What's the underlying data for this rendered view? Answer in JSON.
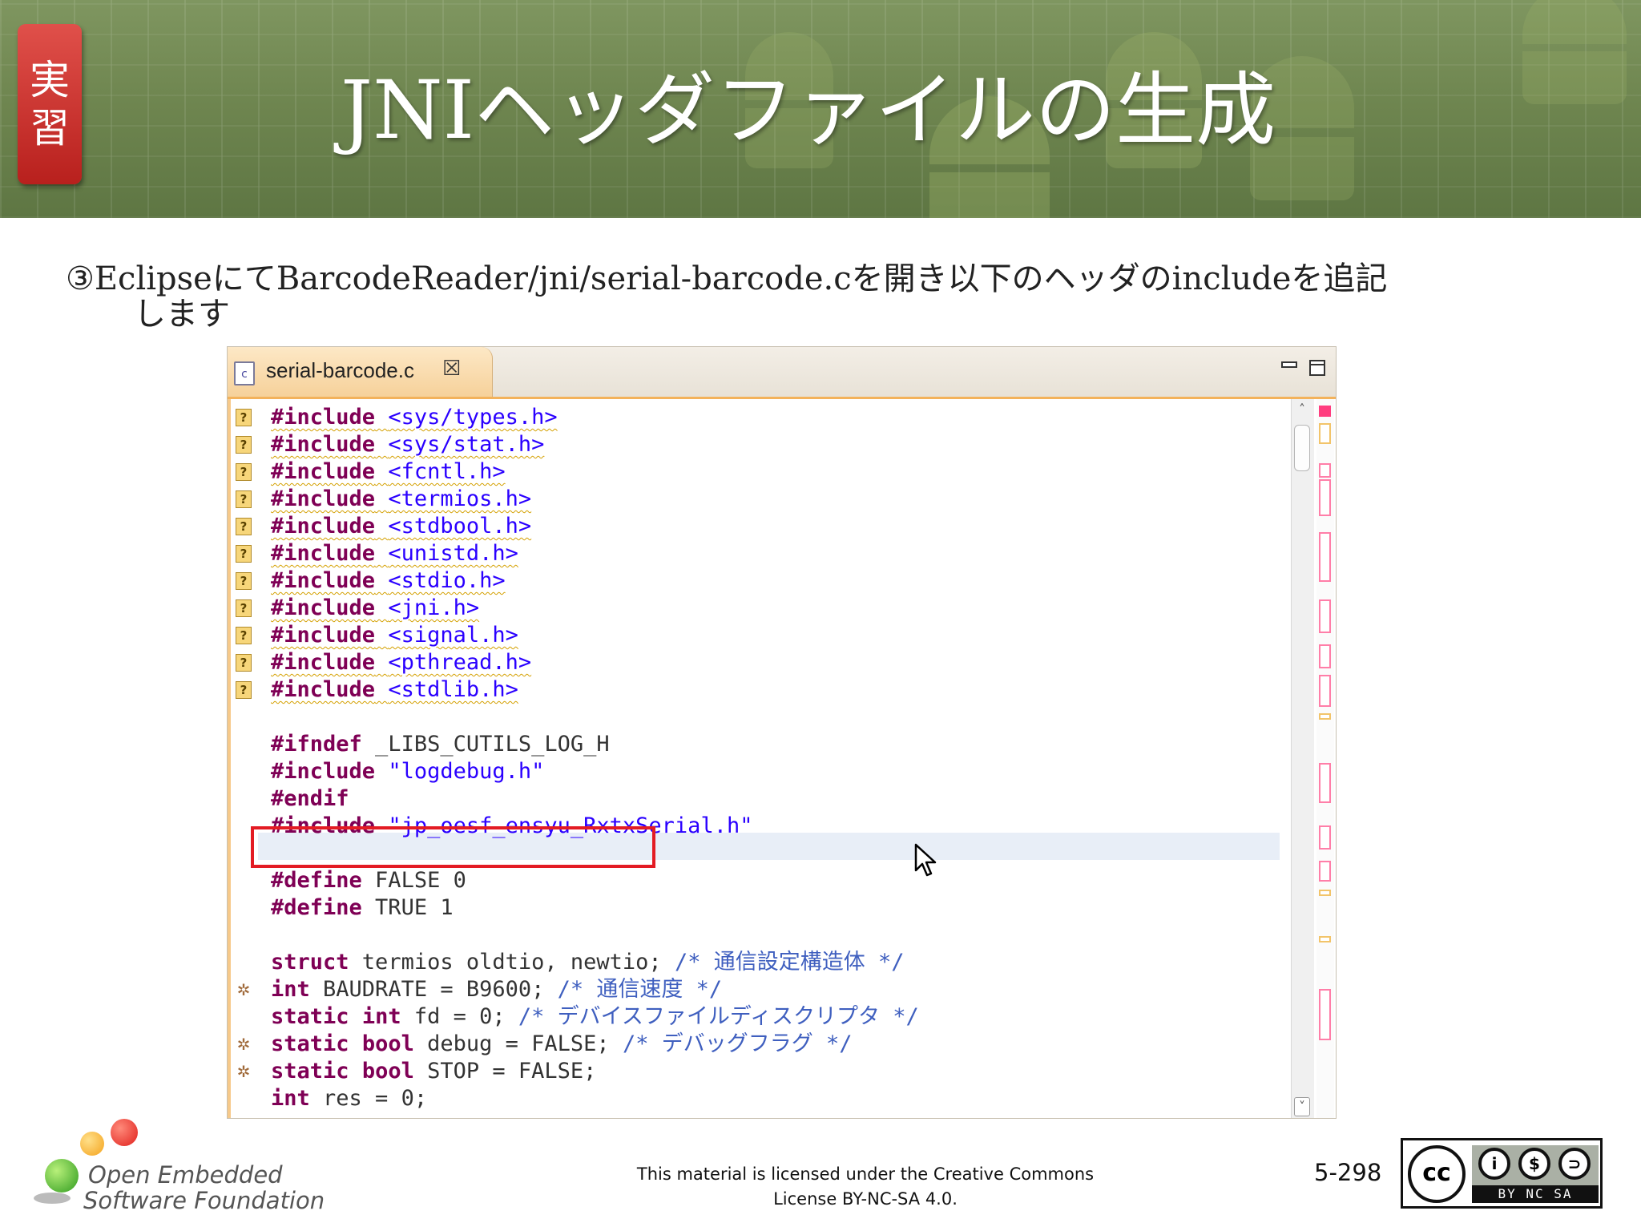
{
  "slide": {
    "badge": "実\n習",
    "title": "JNIヘッダファイルの生成",
    "instruction_line1": "③EclipseにてBarcodeReader/jni/serial-barcode.cを開き以下のヘッダのincludeを追記",
    "instruction_line2": "します"
  },
  "editor": {
    "tab_label": "serial-barcode.c",
    "tab_close": "☒",
    "minimize": "▭",
    "maximize": "□",
    "code_lines": [
      "#include <sys/types.h>",
      "#include <sys/stat.h>",
      "#include <fcntl.h>",
      "#include <termios.h>",
      "#include <stdbool.h>",
      "#include <unistd.h>",
      "#include <stdio.h>",
      "#include <jni.h>",
      "#include <signal.h>",
      "#include <pthread.h>",
      "#include <stdlib.h>",
      "",
      "#ifndef _LIBS_CUTILS_LOG_H",
      "#include \"logdebug.h\"",
      "#endif",
      "#include \"jp_oesf_ensyu_RxtxSerial.h\"",
      "",
      "#define FALSE 0",
      "#define TRUE 1",
      "",
      "struct termios oldtio, newtio; /* 通信設定構造体 */",
      "int BAUDRATE = B9600; /* 通信速度 */",
      "static int fd = 0; /* デバイスファイルディスクリプタ */",
      "static bool debug = FALSE; /* デバッグフラグ */",
      "static bool STOP = FALSE;",
      "int res = 0;"
    ],
    "highlighted_line": "#include \"jp_oesf_ensyu_RxtxSerial.h\"",
    "warning_marker": "?",
    "bug_marker": "✲",
    "scroll_up": "˄",
    "scroll_down": "˅"
  },
  "footer": {
    "logo_line1": "Open Embedded",
    "logo_line2": "Software Foundation",
    "license_line1": "This material is licensed under the Creative Commons",
    "license_line2": "License BY-NC-SA 4.0.",
    "page_number": "5-298",
    "cc_left": "cc",
    "cc_icons": [
      "i",
      "$",
      "⊃"
    ],
    "cc_terms": "BY NC SA"
  },
  "colors": {
    "header_green": "#6f8650",
    "badge_red": "#c8302a",
    "keyword": "#7f0055",
    "string": "#2a00ff",
    "comment": "#3f5fbf",
    "highlight_box": "#e31b23"
  }
}
